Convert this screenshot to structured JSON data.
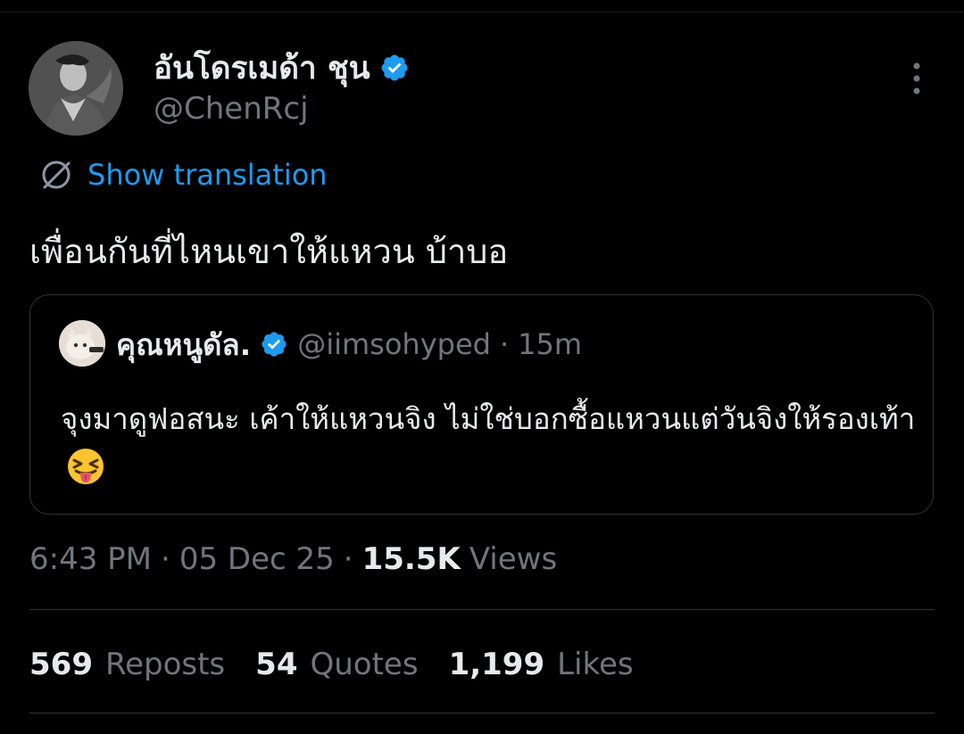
{
  "author": {
    "display_name": "อันโดรเมด้า ชุน",
    "handle": "@ChenRcj",
    "verified_icon": "verified-badge-icon",
    "avatar_icon": "avatar-photo"
  },
  "translate": {
    "icon": "globe-icon",
    "label": "Show translation"
  },
  "tweet": {
    "text": "เพื่อนกันที่ไหนเขาให้แหวน บ้าบอ"
  },
  "quoted": {
    "display_name": "คุณหนูดัล.",
    "handle": "@iimsohyped",
    "separator": "·",
    "time": "15m",
    "text": "จุงมาดูฟอสนะ เค้าให้แหวนจิง ไม่ใช่บอกซื้อแหวนแต่วันจิงให้รองเท้า",
    "emoji_icon": "squinting-face-with-tongue-icon"
  },
  "meta": {
    "time": "6:43 PM",
    "sep1": "·",
    "date": "05 Dec 25",
    "sep2": "·",
    "views_count": "15.5K",
    "views_label": "Views"
  },
  "stats": {
    "reposts_count": "569",
    "reposts_label": "Reposts",
    "quotes_count": "54",
    "quotes_label": "Quotes",
    "likes_count": "1,199",
    "likes_label": "Likes"
  },
  "colors": {
    "background": "#000000",
    "primary_text": "#e7e9ea",
    "secondary_text": "#71767b",
    "accent": "#1d9bf0",
    "border": "#2f3336"
  }
}
